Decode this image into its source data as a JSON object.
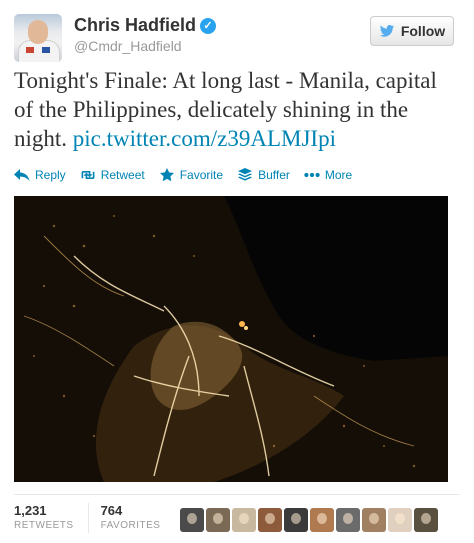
{
  "user": {
    "display_name": "Chris Hadfield",
    "verified_glyph": "✓",
    "handle": "@Cmdr_Hadfield"
  },
  "follow_button": {
    "label": "Follow",
    "icon": "twitter-bird-icon"
  },
  "tweet": {
    "text": "Tonight's Finale: At long last - Manila, capital of the Philippines, delicately shining in the night.",
    "link": "pic.twitter.com/z39ALMJIpi"
  },
  "actions": [
    {
      "label": "Reply",
      "icon": "reply-icon"
    },
    {
      "label": "Retweet",
      "icon": "retweet-icon"
    },
    {
      "label": "Favorite",
      "icon": "star-icon"
    },
    {
      "label": "Buffer",
      "icon": "buffer-icon"
    },
    {
      "label": "More",
      "icon": "more-dots-icon"
    }
  ],
  "stats": {
    "retweets_count": "1,231",
    "retweets_label": "RETWEETS",
    "favorites_count": "764",
    "favorites_label": "FAVORITES"
  },
  "favoriter_count": 10,
  "colors": {
    "link": "#0084b4",
    "verified": "#2aa3ef",
    "muted": "#999999",
    "night_bg": "#050505",
    "city_light": "#ffd58a"
  }
}
